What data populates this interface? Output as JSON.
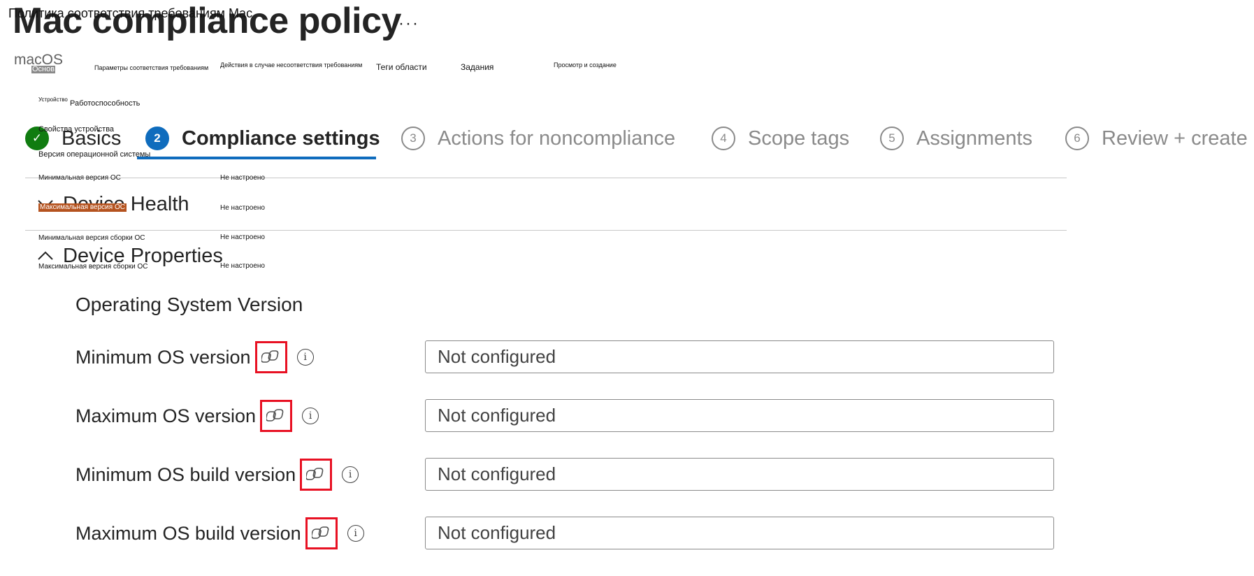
{
  "header": {
    "title": "Mac compliance policy",
    "more_label": "···",
    "subtitle": "macOS"
  },
  "wizard": {
    "steps": [
      {
        "number": "✓",
        "label": "Basics",
        "state": "done"
      },
      {
        "number": "2",
        "label": "Compliance settings",
        "state": "active"
      },
      {
        "number": "3",
        "label": "Actions for noncompliance",
        "state": "pending"
      },
      {
        "number": "4",
        "label": "Scope tags",
        "state": "pending"
      },
      {
        "number": "5",
        "label": "Assignments",
        "state": "pending"
      },
      {
        "number": "6",
        "label": "Review + create",
        "state": "pending"
      }
    ]
  },
  "sections": {
    "device_health": {
      "label": "Device Health",
      "chevron": "chevron-down-icon"
    },
    "device_properties": {
      "label": "Device Properties",
      "chevron": "chevron-up-icon"
    }
  },
  "os_group": {
    "title": "Operating System Version",
    "settings": [
      {
        "label": "Minimum OS version",
        "value": "Not configured"
      },
      {
        "label": "Maximum OS version",
        "value": "Not configured"
      },
      {
        "label": "Minimum OS build version",
        "value": "Not configured"
      },
      {
        "label": "Maximum OS build version",
        "value": "Not configured"
      }
    ]
  },
  "overlay": {
    "title": "Политика соответствия требованиям Mac",
    "tabs": [
      "Основ",
      "Параметры соответствия требованиям",
      "Действия в случае несоответствия требованиям",
      "Теги области",
      "Задания",
      "Просмотр и создание"
    ],
    "tree": {
      "device_label": "Устройство",
      "health": "Работоспособность",
      "properties": "Свойства устройства",
      "os_version": "Версия операционной системы"
    },
    "rows": [
      {
        "label": "Минимальная версия ОС",
        "value": "Не настроено"
      },
      {
        "label": "Максимальная версия ОС",
        "value": "Не настроено"
      },
      {
        "label": "Минимальная версия сборки ОС",
        "value": "Не настроено"
      },
      {
        "label": "Максимальная версия сборки ОС",
        "value": "Не настроено"
      }
    ]
  },
  "colors": {
    "accent": "#0f6cbd",
    "done": "#107c10",
    "highlight_box": "#e81123",
    "overlay_highlight": "#b5531f"
  }
}
